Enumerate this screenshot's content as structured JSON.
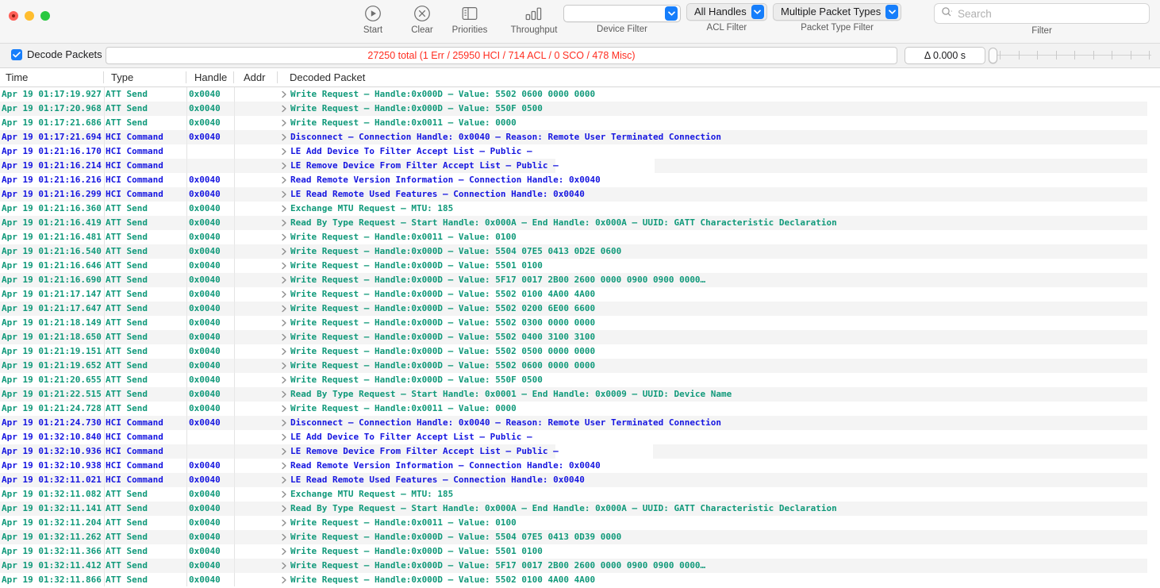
{
  "window": {
    "controls": [
      "close",
      "minimize",
      "maximize"
    ]
  },
  "toolbar": {
    "start": {
      "label": "Start",
      "icon": "play-circle-icon"
    },
    "clear": {
      "label": "Clear",
      "icon": "x-circle-icon"
    },
    "priorities": {
      "label": "Priorities",
      "icon": "sidebar-panel-icon"
    },
    "throughput": {
      "label": "Throughput",
      "icon": "bar-chart-icon"
    },
    "device_filter": {
      "caption": "Device Filter",
      "value": ""
    },
    "acl_filter": {
      "caption": "ACL Filter",
      "value": "All Handles"
    },
    "packet_type_filter": {
      "caption": "Packet Type Filter",
      "value": "Multiple Packet Types"
    },
    "filter": {
      "caption": "Filter",
      "placeholder": "Search",
      "value": "",
      "icon": "search-icon"
    },
    "accent_color": "#167efb"
  },
  "statusbar": {
    "decode_packets": {
      "label": "Decode Packets",
      "checked": true
    },
    "status": "27250 total (1 Err / 25950 HCI / 714 ACL / 0 SCO / 478 Misc)",
    "status_color": "#ff2d20",
    "delta": "Δ 0.000 s",
    "slider": {
      "value": 0,
      "ticks": 9
    }
  },
  "table": {
    "columns": [
      "Time",
      "Type",
      "Handle",
      "Addr",
      "Decoded Packet"
    ],
    "colors": {
      "att": "#10997a",
      "hci": "#1515e0"
    },
    "rows": [
      {
        "time": "Apr 19 01:17:19.927",
        "type": "ATT Send",
        "handle": "0x0040",
        "addr": "",
        "packet": "Write Request – Handle:0x000D – Value: 5502 0600 0000 0000",
        "kind": "att"
      },
      {
        "time": "Apr 19 01:17:20.968",
        "type": "ATT Send",
        "handle": "0x0040",
        "addr": "",
        "packet": "Write Request – Handle:0x000D – Value: 550F 0500",
        "kind": "att"
      },
      {
        "time": "Apr 19 01:17:21.686",
        "type": "ATT Send",
        "handle": "0x0040",
        "addr": "",
        "packet": "Write Request – Handle:0x0011 – Value: 0000",
        "kind": "att"
      },
      {
        "time": "Apr 19 01:17:21.694",
        "type": "HCI Command",
        "handle": "0x0040",
        "addr": "",
        "packet": "Disconnect – Connection Handle: 0x0040 – Reason: Remote User Terminated Connection",
        "kind": "hci"
      },
      {
        "time": "Apr 19 01:21:16.170",
        "type": "HCI Command",
        "handle": "",
        "addr": "",
        "packet": "LE Add Device To Filter Accept List – Public –",
        "kind": "hci"
      },
      {
        "time": "Apr 19 01:21:16.214",
        "type": "HCI Command",
        "handle": "",
        "addr": "",
        "packet": "LE Remove Device From Filter Accept List – Public –",
        "kind": "hci"
      },
      {
        "time": "Apr 19 01:21:16.216",
        "type": "HCI Command",
        "handle": "0x0040",
        "addr": "",
        "packet": "Read Remote Version Information – Connection Handle: 0x0040",
        "kind": "hci"
      },
      {
        "time": "Apr 19 01:21:16.299",
        "type": "HCI Command",
        "handle": "0x0040",
        "addr": "",
        "packet": "LE Read Remote Used Features – Connection Handle: 0x0040",
        "kind": "hci"
      },
      {
        "time": "Apr 19 01:21:16.360",
        "type": "ATT Send",
        "handle": "0x0040",
        "addr": "",
        "packet": "Exchange MTU Request – MTU: 185",
        "kind": "att"
      },
      {
        "time": "Apr 19 01:21:16.419",
        "type": "ATT Send",
        "handle": "0x0040",
        "addr": "",
        "packet": "Read By Type Request – Start Handle: 0x000A – End Handle: 0x000A – UUID: GATT Characteristic Declaration",
        "kind": "att"
      },
      {
        "time": "Apr 19 01:21:16.481",
        "type": "ATT Send",
        "handle": "0x0040",
        "addr": "",
        "packet": "Write Request – Handle:0x0011 – Value: 0100",
        "kind": "att"
      },
      {
        "time": "Apr 19 01:21:16.540",
        "type": "ATT Send",
        "handle": "0x0040",
        "addr": "",
        "packet": "Write Request – Handle:0x000D – Value: 5504 07E5 0413 0D2E 0600",
        "kind": "att"
      },
      {
        "time": "Apr 19 01:21:16.646",
        "type": "ATT Send",
        "handle": "0x0040",
        "addr": "",
        "packet": "Write Request – Handle:0x000D – Value: 5501 0100",
        "kind": "att"
      },
      {
        "time": "Apr 19 01:21:16.690",
        "type": "ATT Send",
        "handle": "0x0040",
        "addr": "",
        "packet": "Write Request – Handle:0x000D – Value: 5F17 0017 2B00 2600 0000 0900 0900 0000…",
        "kind": "att"
      },
      {
        "time": "Apr 19 01:21:17.147",
        "type": "ATT Send",
        "handle": "0x0040",
        "addr": "",
        "packet": "Write Request – Handle:0x000D – Value: 5502 0100 4A00 4A00",
        "kind": "att"
      },
      {
        "time": "Apr 19 01:21:17.647",
        "type": "ATT Send",
        "handle": "0x0040",
        "addr": "",
        "packet": "Write Request – Handle:0x000D – Value: 5502 0200 6E00 6600",
        "kind": "att"
      },
      {
        "time": "Apr 19 01:21:18.149",
        "type": "ATT Send",
        "handle": "0x0040",
        "addr": "",
        "packet": "Write Request – Handle:0x000D – Value: 5502 0300 0000 0000",
        "kind": "att"
      },
      {
        "time": "Apr 19 01:21:18.650",
        "type": "ATT Send",
        "handle": "0x0040",
        "addr": "",
        "packet": "Write Request – Handle:0x000D – Value: 5502 0400 3100 3100",
        "kind": "att"
      },
      {
        "time": "Apr 19 01:21:19.151",
        "type": "ATT Send",
        "handle": "0x0040",
        "addr": "",
        "packet": "Write Request – Handle:0x000D – Value: 5502 0500 0000 0000",
        "kind": "att"
      },
      {
        "time": "Apr 19 01:21:19.652",
        "type": "ATT Send",
        "handle": "0x0040",
        "addr": "",
        "packet": "Write Request – Handle:0x000D – Value: 5502 0600 0000 0000",
        "kind": "att"
      },
      {
        "time": "Apr 19 01:21:20.655",
        "type": "ATT Send",
        "handle": "0x0040",
        "addr": "",
        "packet": "Write Request – Handle:0x000D – Value: 550F 0500",
        "kind": "att"
      },
      {
        "time": "Apr 19 01:21:22.515",
        "type": "ATT Send",
        "handle": "0x0040",
        "addr": "",
        "packet": "Read By Type Request – Start Handle: 0x0001 – End Handle: 0x0009 – UUID: Device Name",
        "kind": "att"
      },
      {
        "time": "Apr 19 01:21:24.728",
        "type": "ATT Send",
        "handle": "0x0040",
        "addr": "",
        "packet": "Write Request – Handle:0x0011 – Value: 0000",
        "kind": "att"
      },
      {
        "time": "Apr 19 01:21:24.730",
        "type": "HCI Command",
        "handle": "0x0040",
        "addr": "",
        "packet": "Disconnect – Connection Handle: 0x0040 – Reason: Remote User Terminated Connection",
        "kind": "hci"
      },
      {
        "time": "Apr 19 01:32:10.840",
        "type": "HCI Command",
        "handle": "",
        "addr": "",
        "packet": "LE Add Device To Filter Accept List – Public –",
        "kind": "hci"
      },
      {
        "time": "Apr 19 01:32:10.936",
        "type": "HCI Command",
        "handle": "",
        "addr": "",
        "packet": "LE Remove Device From Filter Accept List – Public –",
        "kind": "hci"
      },
      {
        "time": "Apr 19 01:32:10.938",
        "type": "HCI Command",
        "handle": "0x0040",
        "addr": "",
        "packet": "Read Remote Version Information – Connection Handle: 0x0040",
        "kind": "hci"
      },
      {
        "time": "Apr 19 01:32:11.021",
        "type": "HCI Command",
        "handle": "0x0040",
        "addr": "",
        "packet": "LE Read Remote Used Features – Connection Handle: 0x0040",
        "kind": "hci"
      },
      {
        "time": "Apr 19 01:32:11.082",
        "type": "ATT Send",
        "handle": "0x0040",
        "addr": "",
        "packet": "Exchange MTU Request – MTU: 185",
        "kind": "att"
      },
      {
        "time": "Apr 19 01:32:11.141",
        "type": "ATT Send",
        "handle": "0x0040",
        "addr": "",
        "packet": "Read By Type Request – Start Handle: 0x000A – End Handle: 0x000A – UUID: GATT Characteristic Declaration",
        "kind": "att"
      },
      {
        "time": "Apr 19 01:32:11.204",
        "type": "ATT Send",
        "handle": "0x0040",
        "addr": "",
        "packet": "Write Request – Handle:0x0011 – Value: 0100",
        "kind": "att"
      },
      {
        "time": "Apr 19 01:32:11.262",
        "type": "ATT Send",
        "handle": "0x0040",
        "addr": "",
        "packet": "Write Request – Handle:0x000D – Value: 5504 07E5 0413 0D39 0000",
        "kind": "att"
      },
      {
        "time": "Apr 19 01:32:11.366",
        "type": "ATT Send",
        "handle": "0x0040",
        "addr": "",
        "packet": "Write Request – Handle:0x000D – Value: 5501 0100",
        "kind": "att"
      },
      {
        "time": "Apr 19 01:32:11.412",
        "type": "ATT Send",
        "handle": "0x0040",
        "addr": "",
        "packet": "Write Request – Handle:0x000D – Value: 5F17 0017 2B00 2600 0000 0900 0900 0000…",
        "kind": "att"
      },
      {
        "time": "Apr 19 01:32:11.866",
        "type": "ATT Send",
        "handle": "0x0040",
        "addr": "",
        "packet": "Write Request – Handle:0x000D – Value: 5502 0100 4A00 4A00",
        "kind": "att"
      }
    ]
  }
}
